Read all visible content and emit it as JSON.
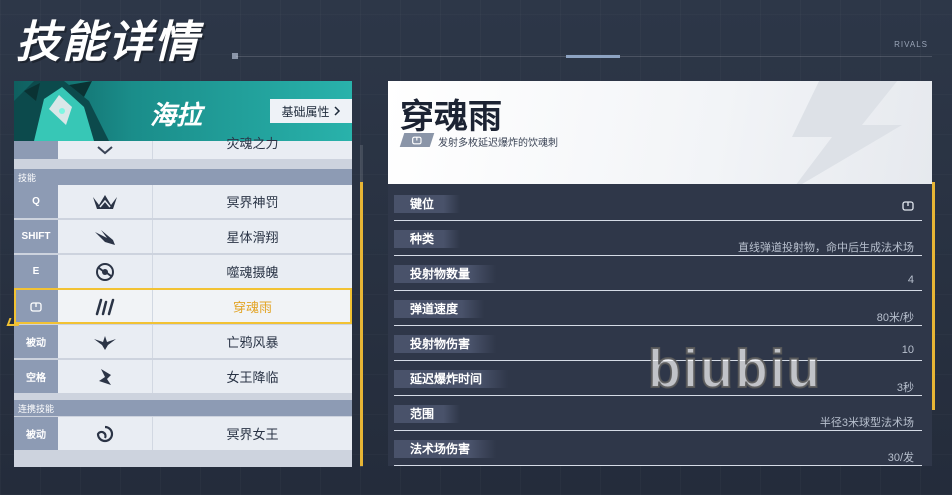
{
  "header": {
    "title": "技能详情",
    "brand": "RIVALS"
  },
  "hero": {
    "name": "海拉",
    "base_button": "基础属性",
    "chevron": "chevron-right-icon"
  },
  "skill_list": {
    "partial_row": {
      "name": "灾魂之力"
    },
    "section_skills": "技能",
    "rows": [
      {
        "key": "Q",
        "name": "冥界神罚",
        "icon": "crown-icon"
      },
      {
        "key": "SHIFT",
        "name": "星体滑翔",
        "icon": "glide-bird-icon"
      },
      {
        "key": "E",
        "name": "噬魂摄魄",
        "icon": "orb-icon"
      },
      {
        "key": "",
        "name": "穿魂雨",
        "icon": "claw-rain-icon",
        "selected": true
      },
      {
        "key": "被动",
        "name": "亡鸦风暴",
        "icon": "raven-icon"
      },
      {
        "key": "空格",
        "name": "女王降临",
        "icon": "dive-icon"
      }
    ],
    "section_combo": "连携技能",
    "combo_rows": [
      {
        "key": "被动",
        "name": "冥界女王",
        "icon": "swirl-icon"
      }
    ]
  },
  "detail": {
    "title": "穿魂雨",
    "subtitle": "发射多枚延迟爆炸的饮魂刺",
    "key_icon": "mouse-button-icon",
    "attributes": [
      {
        "label": "键位",
        "value": ""
      },
      {
        "label": "种类",
        "value": "直线弹道投射物，命中后生成法术场"
      },
      {
        "label": "投射物数量",
        "value": "4"
      },
      {
        "label": "弹道速度",
        "value": "80米/秒"
      },
      {
        "label": "投射物伤害",
        "value": "10"
      },
      {
        "label": "延迟爆炸时间",
        "value": "3秒"
      },
      {
        "label": "范围",
        "value": "半径3米球型法术场"
      },
      {
        "label": "法术场伤害",
        "value": "30/发"
      }
    ]
  },
  "watermark": "biubiu",
  "colors": {
    "accent": "#f2c233",
    "hero_banner": "#1a8d8a",
    "selected_text": "#e3a426"
  }
}
